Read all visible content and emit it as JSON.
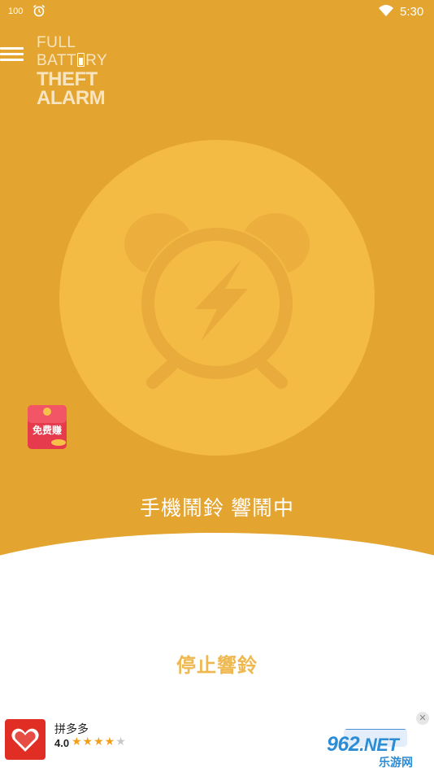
{
  "status_bar": {
    "battery_level": "100",
    "time": "5:30",
    "icons": [
      "alarm-clock-icon",
      "wifi-icon"
    ]
  },
  "header": {
    "menu_icon": "hamburger-menu-icon",
    "logo": {
      "line1": "FULL",
      "line2_prefix": "BATT",
      "line2_suffix": "RY",
      "line3": "THEFT",
      "line4": "ALARM"
    }
  },
  "main": {
    "alarm_icon": "lightning-alarm-clock-icon",
    "status_text": "手機鬧鈴 響鬧中",
    "stop_button": "停止響鈴"
  },
  "floating_badge": {
    "icon": "red-envelope-icon",
    "label": "免费赚"
  },
  "ad": {
    "app_name": "拼多多",
    "rating": "4.0",
    "stars_filled": 4,
    "stars_total": 5,
    "close_icon": "close-icon"
  },
  "watermark": {
    "line1": "962",
    "line1_suffix": ".NET",
    "line2": "乐游网"
  },
  "colors": {
    "background_top": "#E4A430",
    "circle": "#F3BB44",
    "stop_text": "#EEB84E"
  }
}
